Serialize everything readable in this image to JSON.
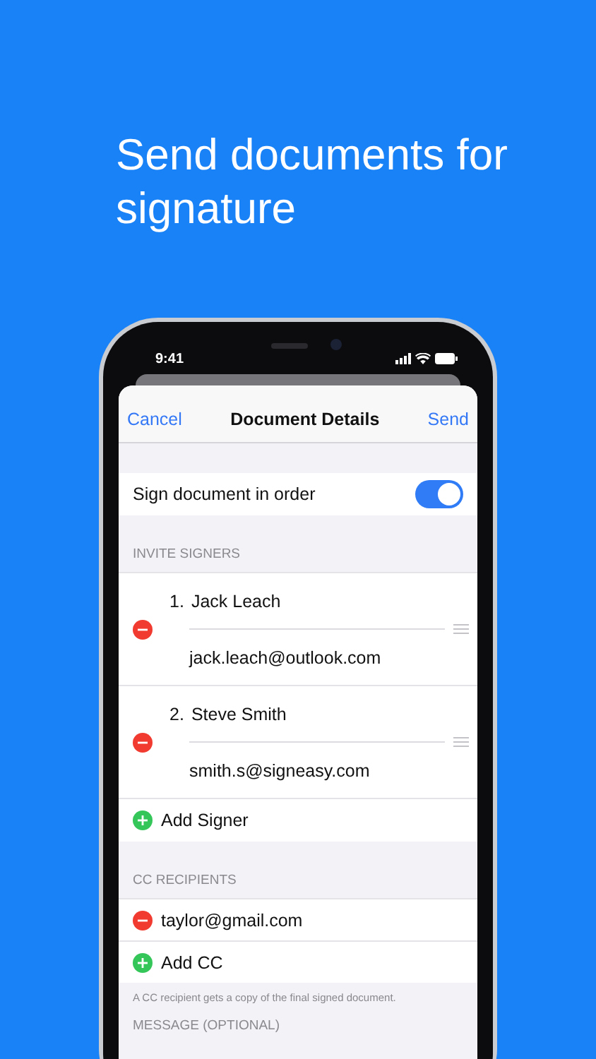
{
  "headline": "Send documents for signature",
  "status_bar": {
    "time": "9:41"
  },
  "nav": {
    "left": "Cancel",
    "title": "Document Details",
    "right": "Send"
  },
  "toggle": {
    "label": "Sign document in order",
    "on": true
  },
  "signers_header": "INVITE SIGNERS",
  "signers": [
    {
      "number": "1.",
      "name": "Jack Leach",
      "email": "jack.leach@outlook.com"
    },
    {
      "number": "2.",
      "name": "Steve Smith",
      "email": "smith.s@signeasy.com"
    }
  ],
  "add_signer": "Add Signer",
  "cc_header": "CC RECIPIENTS",
  "cc": [
    {
      "email": "taylor@gmail.com"
    }
  ],
  "add_cc": "Add CC",
  "cc_note": "A CC recipient gets a copy of the final signed document.",
  "message_header": "MESSAGE (OPTIONAL)"
}
